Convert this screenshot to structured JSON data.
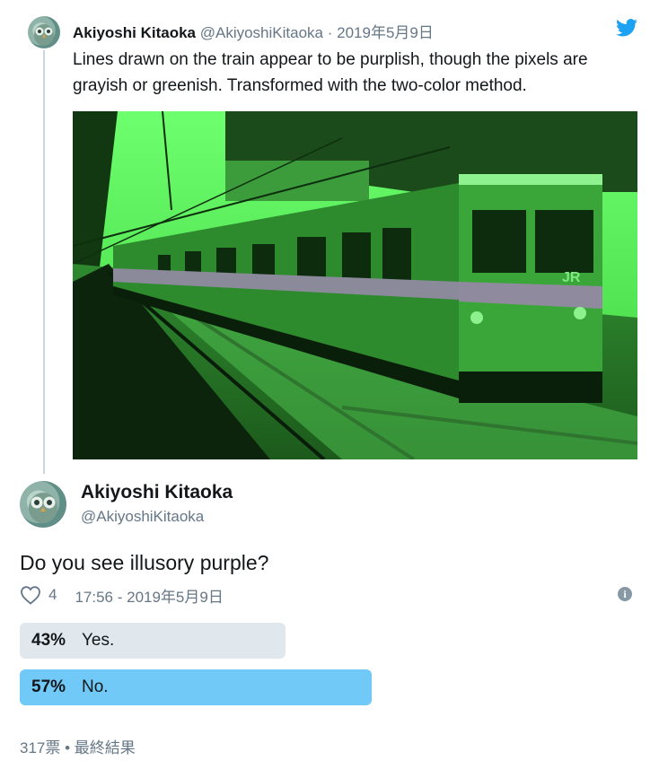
{
  "quoted_tweet": {
    "author_name": "Akiyoshi Kitaoka",
    "author_handle": "@AkiyoshiKitaoka",
    "separator": "·",
    "date": "2019年5月9日",
    "text": "Lines drawn on the train appear to be purplish, though the pixels are grayish or greenish. Transformed with the two-color method.",
    "image_alt": "green-tinted photo of a train at a station platform"
  },
  "main_tweet": {
    "author_name": "Akiyoshi Kitaoka",
    "author_handle": "@AkiyoshiKitaoka",
    "text": "Do you see illusory purple?",
    "like_count": "4",
    "timestamp": "17:56 - 2019年5月9日"
  },
  "poll": {
    "options": [
      {
        "percent": "43%",
        "label": "Yes.",
        "fraction": 0.43
      },
      {
        "percent": "57%",
        "label": "No.",
        "fraction": 0.57
      }
    ],
    "footer": "317票 • 最終結果"
  },
  "colors": {
    "brand": "#1da1f2",
    "winning_option": "#71c9f8",
    "losing_option": "#e1e8ed",
    "secondary_text": "#657786"
  },
  "icons": [
    "twitter-bird-icon",
    "heart-icon",
    "info-icon"
  ]
}
